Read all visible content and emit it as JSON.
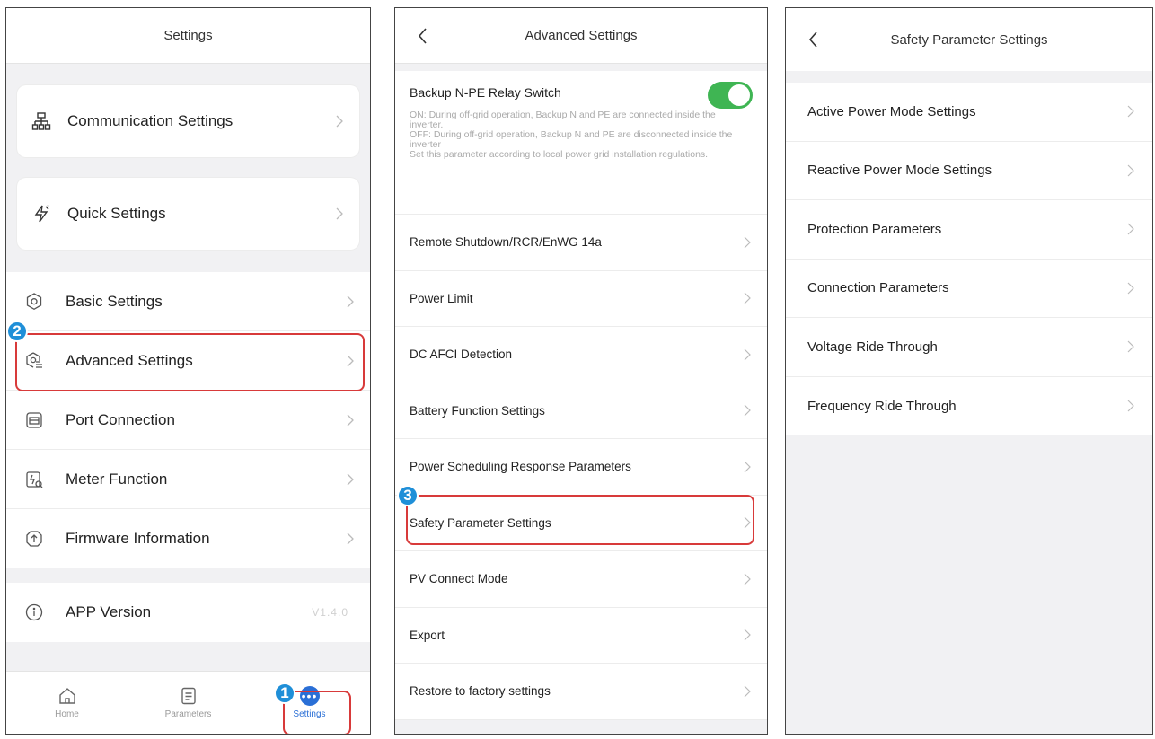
{
  "settings_screen": {
    "title": "Settings",
    "cards": [
      {
        "label": "Communication Settings",
        "icon": "network-icon"
      },
      {
        "label": "Quick Settings",
        "icon": "lightning-icon"
      }
    ],
    "items": [
      {
        "label": "Basic Settings",
        "icon": "gear-icon"
      },
      {
        "label": "Advanced Settings",
        "icon": "gear-settings-icon"
      },
      {
        "label": "Port Connection",
        "icon": "port-icon"
      },
      {
        "label": "Meter Function",
        "icon": "meter-icon"
      },
      {
        "label": "Firmware Information",
        "icon": "upload-icon"
      }
    ],
    "app_version": {
      "label": "APP Version",
      "value": "V1.4.0"
    },
    "tabs": [
      {
        "label": "Home",
        "icon": "home-icon"
      },
      {
        "label": "Parameters",
        "icon": "document-icon"
      },
      {
        "label": "Settings",
        "icon": "more-icon",
        "active": true
      }
    ]
  },
  "advanced_screen": {
    "title": "Advanced Settings",
    "relay": {
      "title": "Backup N-PE Relay Switch",
      "enabled": true,
      "description": "ON: During off-grid operation, Backup N and PE are connected inside the inverter.\nOFF: During off-grid operation, Backup N and PE are disconnected inside the inverter\nSet this parameter according to local power grid installation regulations."
    },
    "items": [
      "Remote Shutdown/RCR/EnWG 14a",
      "Power Limit",
      "DC AFCI Detection",
      "Battery Function Settings",
      "Power Scheduling Response Parameters",
      "Safety Parameter Settings",
      "PV Connect Mode",
      "Export",
      "Restore to factory settings"
    ]
  },
  "safety_screen": {
    "title": "Safety Parameter Settings",
    "items": [
      "Active Power Mode Settings",
      "Reactive Power Mode Settings",
      "Protection Parameters",
      "Connection Parameters",
      "Voltage Ride Through",
      "Frequency Ride Through"
    ]
  },
  "steps": [
    "1",
    "2",
    "3"
  ],
  "colors": {
    "highlight": "#d83a3a",
    "step_badge": "#1f8fd8",
    "toggle_on": "#3fb553",
    "accent": "#2a6fd6"
  }
}
